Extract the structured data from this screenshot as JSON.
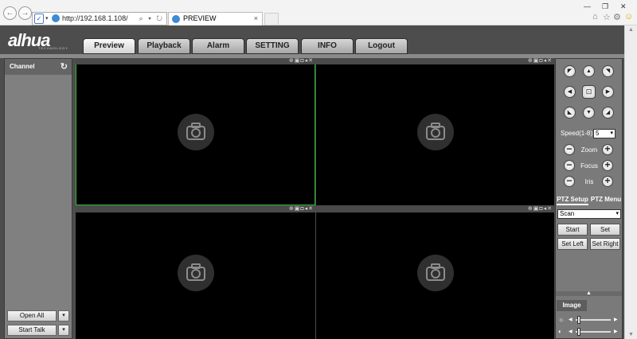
{
  "browser": {
    "url": "http://192.168.1.108/",
    "tab_title": "PREVIEW",
    "tab_close": "×",
    "back": "←",
    "forward": "→",
    "addr_tools": "⌕ ▾ ↻",
    "win_minimize": "—",
    "win_restore": "❐",
    "win_close": "✕",
    "home": "⌂",
    "favorites": "☆",
    "settings": "⚙",
    "smiley": "☺"
  },
  "app": {
    "logo": "alhua",
    "logo_sub": "TECHNOLOGY",
    "tabs": [
      {
        "label": "Preview"
      },
      {
        "label": "Playback"
      },
      {
        "label": "Alarm"
      },
      {
        "label": "SETTING"
      },
      {
        "label": "INFO"
      },
      {
        "label": "Logout"
      }
    ]
  },
  "left_panel": {
    "title": "Channel",
    "refresh_icon": "↻",
    "open_all": "Open All",
    "start_talk": "Start Talk",
    "dropdown_arrow": "▾"
  },
  "video": {
    "pane_icons": "⊕▣◘◂✕"
  },
  "ptz": {
    "arrows": {
      "up_left": "◤",
      "up": "▲",
      "up_right": "◥",
      "left": "◀",
      "center": "⊡",
      "right": "▶",
      "down_left": "◣",
      "down": "▼",
      "down_right": "◢"
    },
    "speed_label": "Speed(1-8):",
    "speed_value": "5",
    "zoom": "Zoom",
    "focus": "Focus",
    "iris": "Iris",
    "minus": "−",
    "plus": "+",
    "tab_setup": "PTZ Setup",
    "tab_menu": "PTZ Menu",
    "mode_value": "Scan",
    "start": "Start",
    "set": "Set",
    "set_left": "Set Left",
    "set_right": "Set Right",
    "collapse_icon": "▲",
    "image_tab": "Image",
    "brightness_icon": "☼",
    "contrast_icon": "◐",
    "slider_left": "◀",
    "slider_right": "▶"
  }
}
